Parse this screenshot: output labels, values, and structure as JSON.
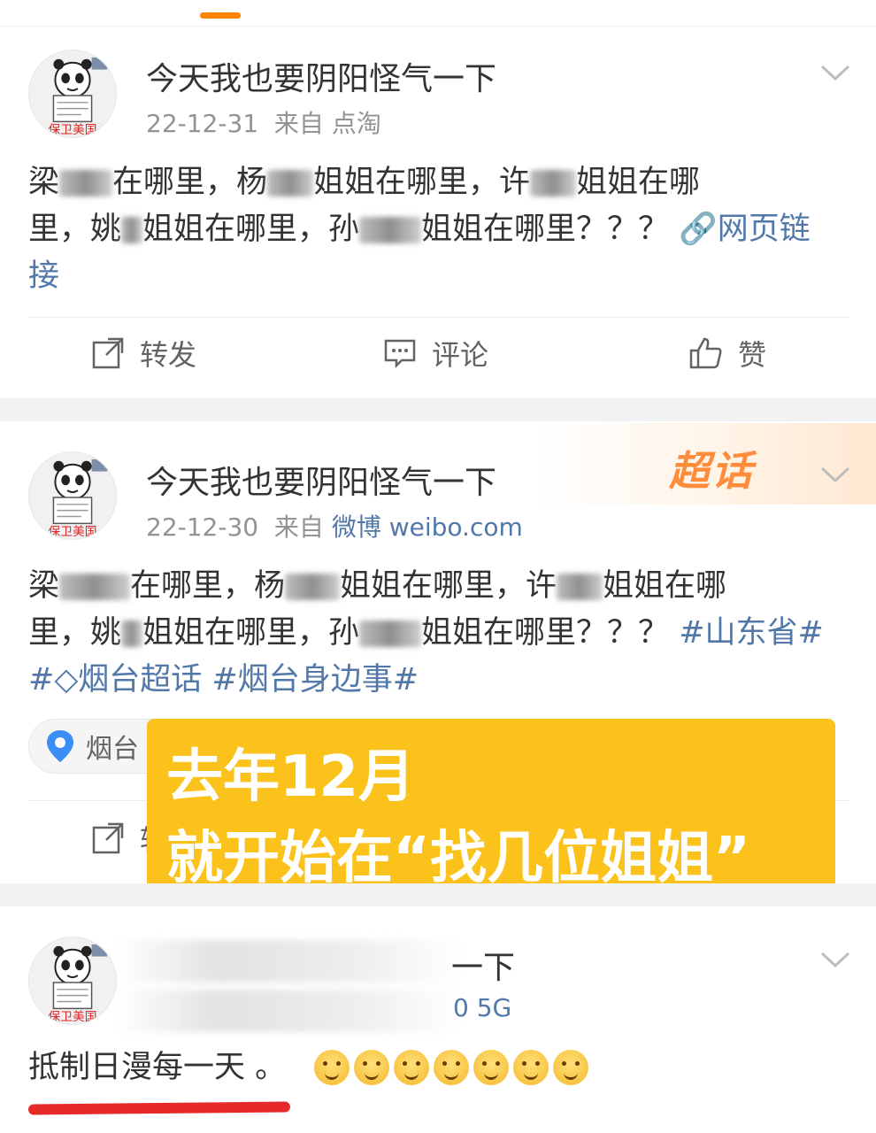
{
  "colors": {
    "accent_orange": "#ff8200",
    "link_blue": "#5278aa",
    "overlay_yellow": "#fbc21c",
    "underline_red": "#e62a2a"
  },
  "posts": [
    {
      "username": "今天我也要阴阳怪气一下",
      "date": "22-12-31",
      "source_prefix": "来自",
      "source": "点淘",
      "body_segments": [
        "梁",
        "在哪里，杨",
        "姐姐在哪里，许",
        "姐姐在哪",
        "里，姚",
        "姐姐在哪里，孙",
        "姐姐在哪里？？？"
      ],
      "link_text": "网页链接",
      "avatar_caption": "保卫美国",
      "actions": {
        "repost": "转发",
        "comment": "评论",
        "like": "赞"
      }
    },
    {
      "username": "今天我也要阴阳怪气一下",
      "date": "22-12-30",
      "source_prefix": "来自",
      "source": "微博 weibo.com",
      "body_segments": [
        "梁",
        "在哪里，杨",
        "姐姐在哪里，许",
        "姐姐在哪",
        "里，姚",
        "姐姐在哪里，孙",
        "姐姐在哪里？？？"
      ],
      "hashtags": [
        "#山东省#",
        "烟台超话",
        "#烟台身边事#"
      ],
      "badge": "超话",
      "location": "烟台",
      "avatar_caption": "保卫美国",
      "actions": {
        "repost": "转发"
      }
    },
    {
      "username_visible": "一下",
      "meta_visible": "0 5G",
      "body": "抵制日漫每一天 。",
      "avatar_caption": "保卫美国",
      "emoji": [
        "grin",
        "expressionless",
        "grin",
        "grin",
        "surprised",
        "surprised",
        "surprised"
      ]
    }
  ],
  "overlay": {
    "line1": "去年12月",
    "line2": "就开始在“找几位姐姐”"
  }
}
